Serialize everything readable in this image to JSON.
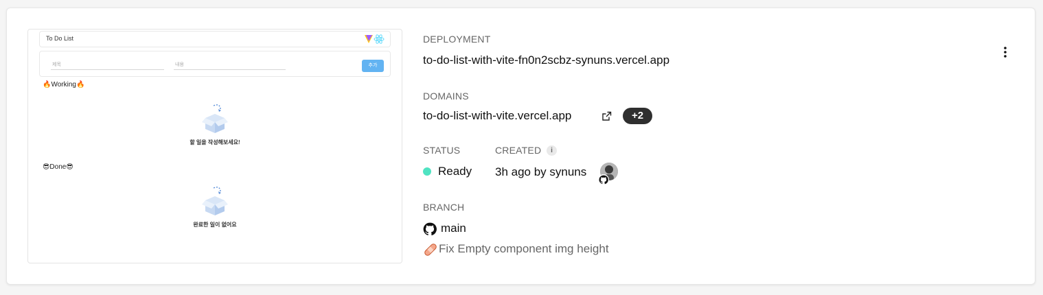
{
  "preview": {
    "title": "To Do List",
    "input_title_placeholder": "제목",
    "input_content_placeholder": "내용",
    "add_button": "추가",
    "working_heading": "🔥Working🔥",
    "working_empty": "할 일을 작성해보세요!",
    "done_heading": "😎Done😎",
    "done_empty": "완료한 일이 없어요"
  },
  "deployment": {
    "label": "DEPLOYMENT",
    "url": "to-do-list-with-vite-fn0n2scbz-synuns.vercel.app"
  },
  "domains": {
    "label": "DOMAINS",
    "primary": "to-do-list-with-vite.vercel.app",
    "extra_count": "+2"
  },
  "status": {
    "label": "STATUS",
    "value": "Ready",
    "color": "#50e3c2"
  },
  "created": {
    "label": "CREATED",
    "value": "3h ago by synuns"
  },
  "branch": {
    "label": "BRANCH",
    "name": "main",
    "commit_message": "Fix Empty component img height"
  },
  "icons": {
    "more": "more-vertical-icon",
    "external_link": "external-link-icon",
    "info": "info-icon",
    "github": "github-icon",
    "commit_emoji": "adhesive-bandage-icon"
  }
}
